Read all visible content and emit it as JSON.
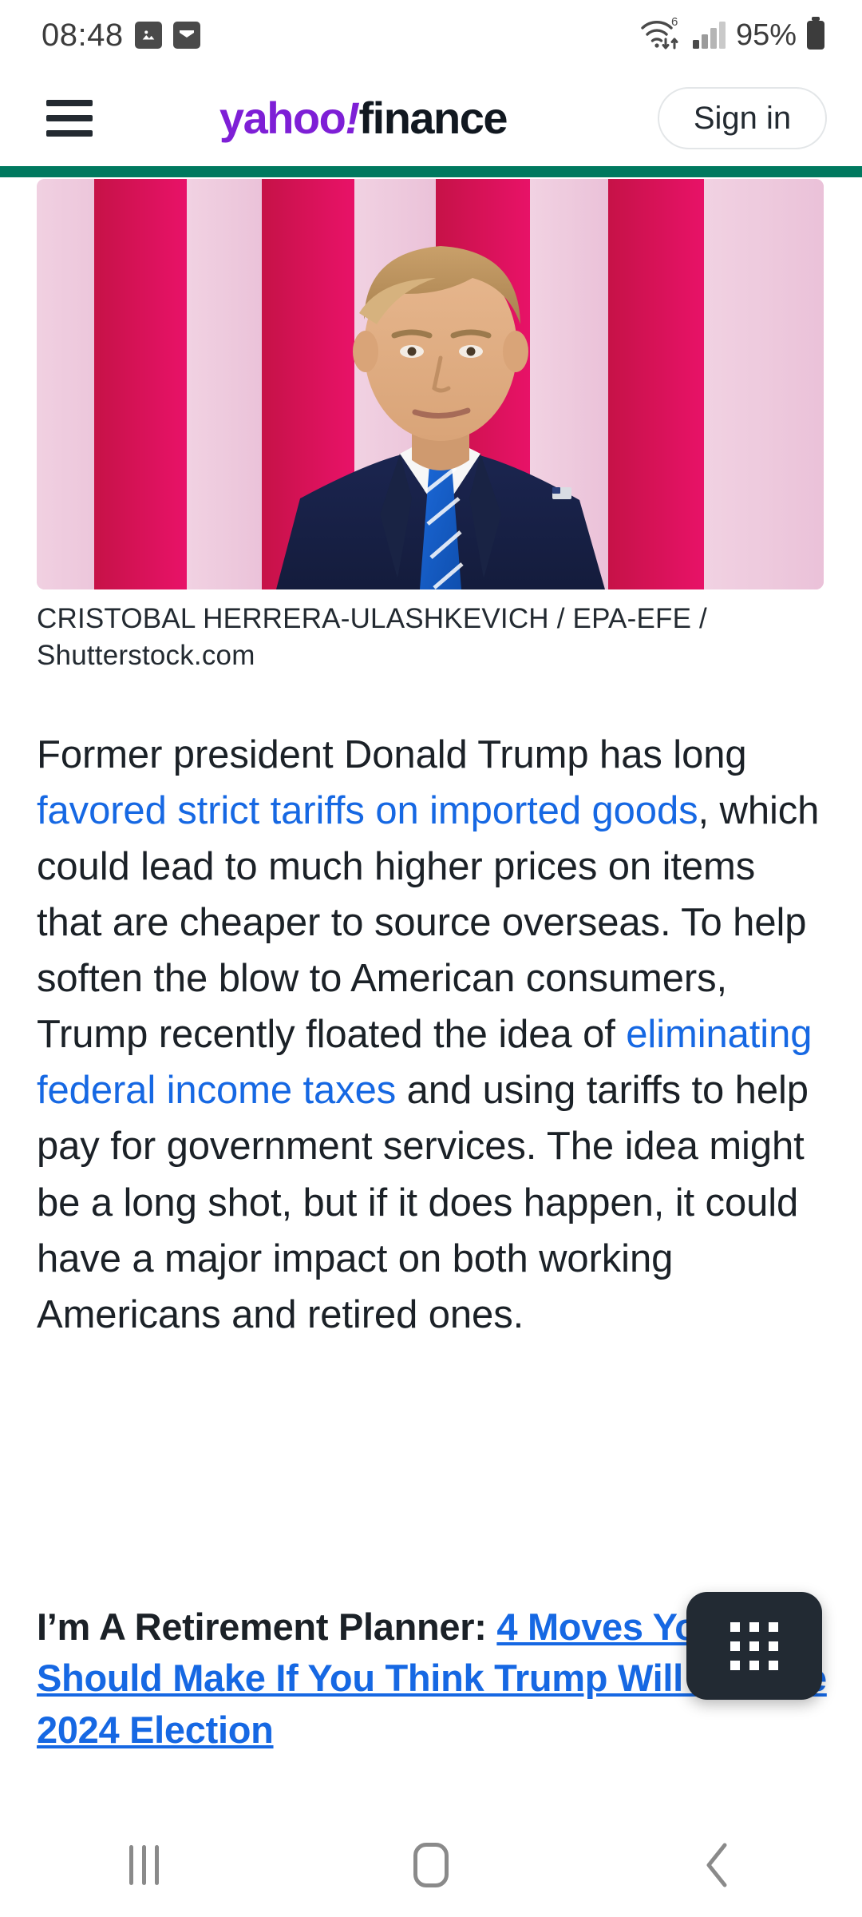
{
  "statusbar": {
    "time": "08:48",
    "icons_left": [
      "photo-icon",
      "mail-icon"
    ],
    "icons_right": [
      "wifi6-icon",
      "signal-bars-icon",
      "battery-icon"
    ],
    "battery_label": "95%"
  },
  "header": {
    "menu_icon": "hamburger-menu-icon",
    "logo_yahoo": "yahoo",
    "logo_bang": "!",
    "logo_finance": "finance",
    "signin_label": "Sign in",
    "brand_purple": "#7e1fd6",
    "brand_dark": "#111820",
    "rule_color": "#00795f"
  },
  "article": {
    "image_alt": "Donald Trump in front of American flags",
    "caption": "CRISTOBAL HERRERA-ULASHKEVICH / EPA-EFE / Shutterstock.com",
    "paragraph": {
      "s1": "Former president Donald Trump has long ",
      "link1": "favored strict tariffs on imported goods",
      "s2": ", which could lead to much higher prices on items that are cheaper to source overseas. To help soften the blow to American consumers, Trump recently floated the idea of ",
      "link2": "eliminating federal income taxes",
      "s3": " and using tariffs to help pay for government services. The idea might be a long shot, but if it does happen, it could have a major impact on both working Americans and retired ones."
    },
    "promo": {
      "prefix": "I’m A Retirement Planner: ",
      "link": "4 Moves You Should Make If You Think Trump Will Win the 2024 Election"
    },
    "link_color": "#1668e3"
  },
  "fab": {
    "icon": "apps-grid-icon"
  },
  "navbar": {
    "recents_label": "recents-icon",
    "home_label": "home-icon",
    "back_label": "back-icon"
  }
}
